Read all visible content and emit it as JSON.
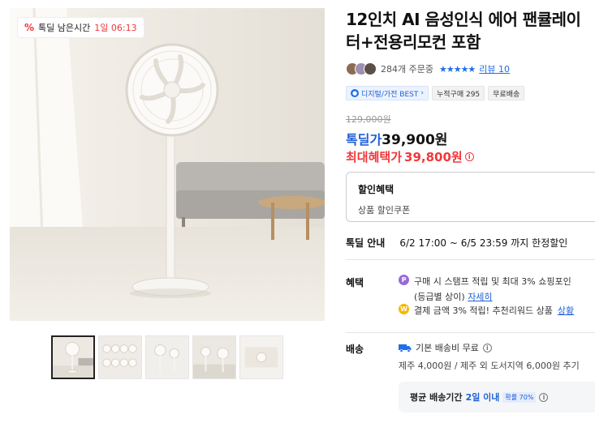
{
  "deal_timer": {
    "label": "톡딜 남은시간",
    "time": "1일 06:13"
  },
  "product": {
    "title": "12인치 AI 음성인식 에어 팬큘레이터+전용리모컨 포함",
    "order_count": "284개 주문중",
    "stars": "★★★★★",
    "review_link": "리뷰 10"
  },
  "badges": [
    {
      "label": "디지털/가전 BEST",
      "icon": "category-badge-icon"
    },
    {
      "label": "누적구매 295"
    },
    {
      "label": "무료배송"
    }
  ],
  "price": {
    "original": "129,000원",
    "deal_label": "톡딜가",
    "deal": "39,900원",
    "max_label": "최대혜택가",
    "max": "39,800원"
  },
  "discount_box": {
    "title": "할인혜택",
    "item": "상품 할인쿠폰"
  },
  "deal_info": {
    "label": "톡딜 안내",
    "value": "6/2 17:00 ~ 6/5 23:59 까지 한정할인"
  },
  "benefits": {
    "label": "혜택",
    "line1": "구매 시 스탬프 적립 및 최대 3% 쇼핑포인",
    "line1_sub": "(등급별 상이)",
    "line1_link": "자세히",
    "line2": "결제 금액 3% 적립! 추천리워드 상품",
    "line2_link": "상황"
  },
  "shipping": {
    "label": "배송",
    "line1": "기본 배송비 무료",
    "line2": "제주 4,000원 / 제주 외 도서지역 6,000원 추기",
    "avg_label": "평균 배송기간",
    "avg_value": "2일 이내",
    "avg_pct": "확률 70%"
  },
  "colors": {
    "accent_blue": "#1f5fd6",
    "accent_red": "#f0383a"
  }
}
